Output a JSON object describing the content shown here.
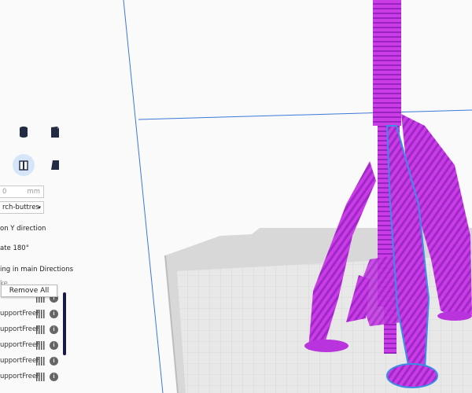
{
  "left_panel": {
    "length_value": "0",
    "length_unit": "mm",
    "type_dropdown": "rch-buttres",
    "option_y_direction": "on Y direction",
    "option_rotate": "ate 180°",
    "option_main_dirs": "ing in main Directions",
    "option_hidden": "ke"
  },
  "support_list": {
    "remove_all_label": "Remove All",
    "items": [
      {
        "name": "",
        "badge": "i"
      },
      {
        "name": "upportFreeF",
        "badge": "i"
      },
      {
        "name": "upportFreeF",
        "badge": "i"
      },
      {
        "name": "upportFreeF",
        "badge": "i"
      },
      {
        "name": "upportFreeF",
        "badge": "i"
      },
      {
        "name": "upportFreeF",
        "badge": "i"
      }
    ]
  },
  "colors": {
    "model_purple": "#c93ce6",
    "model_dark": "#8a1fb0",
    "selection_outline": "#3a8ee6",
    "build_plate": "#dcdcdc",
    "accent_selected": "#d6e6f8"
  },
  "icons": [
    "cylinder-icon",
    "cube-icon",
    "tube-icon",
    "wedge-icon",
    "grid-icon",
    "info-icon"
  ]
}
